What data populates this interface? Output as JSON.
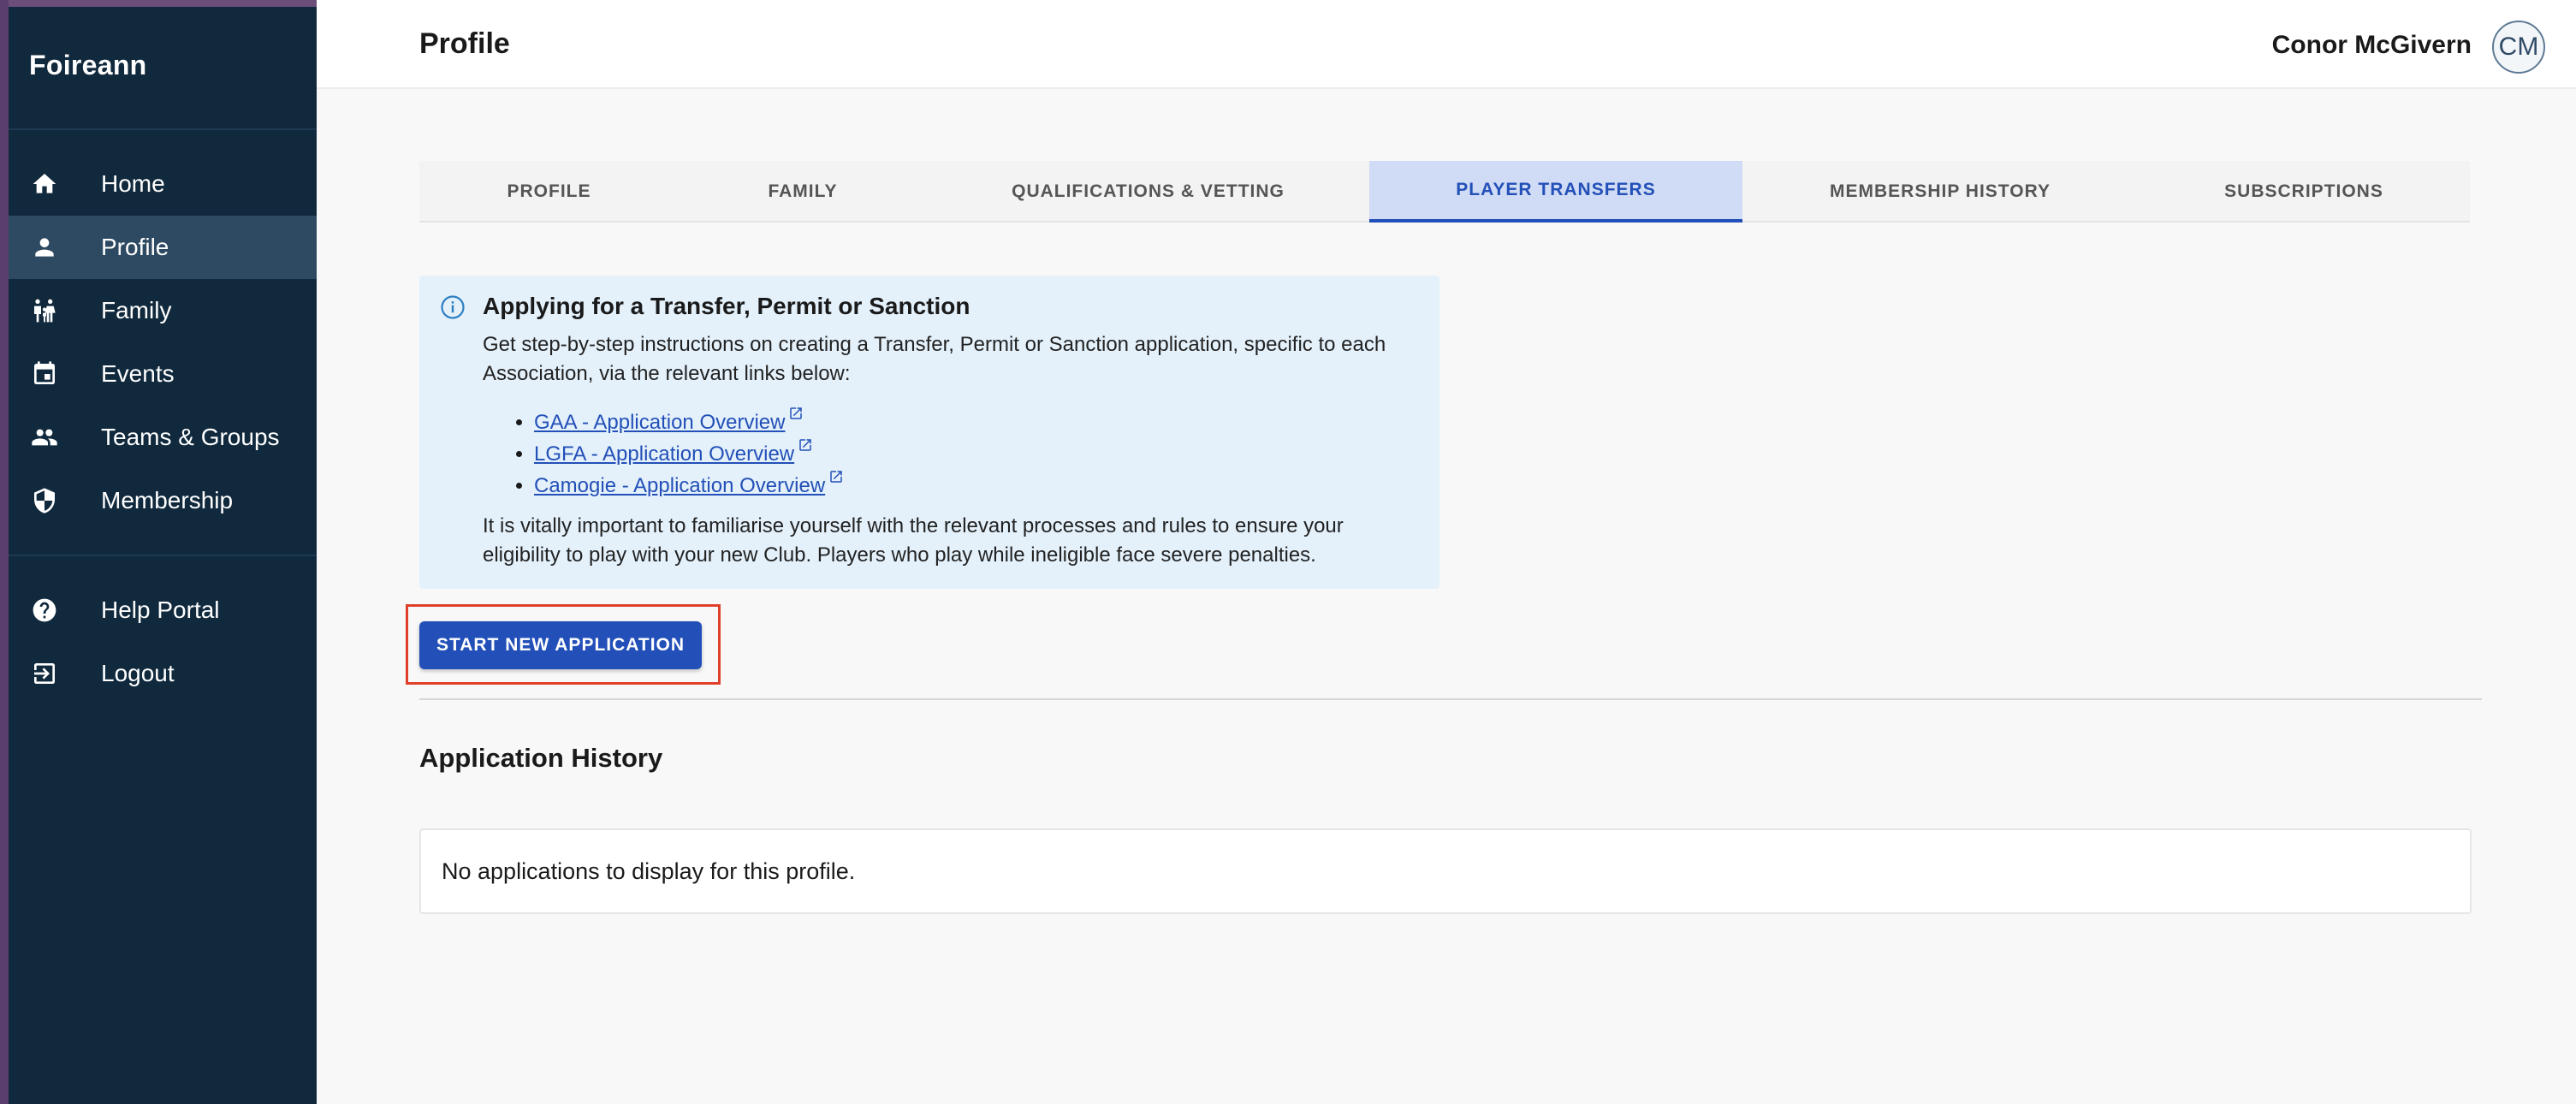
{
  "app": {
    "name": "Foireann"
  },
  "sidebar": {
    "items": [
      {
        "label": "Home",
        "icon": "home-icon"
      },
      {
        "label": "Profile",
        "icon": "person-icon",
        "active": true
      },
      {
        "label": "Family",
        "icon": "family-icon"
      },
      {
        "label": "Events",
        "icon": "calendar-icon"
      },
      {
        "label": "Teams & Groups",
        "icon": "group-icon"
      },
      {
        "label": "Membership",
        "icon": "shield-icon"
      }
    ],
    "secondary_items": [
      {
        "label": "Help Portal",
        "icon": "help-icon"
      },
      {
        "label": "Logout",
        "icon": "logout-icon"
      }
    ]
  },
  "header": {
    "title": "Profile",
    "user_name": "Conor McGivern",
    "avatar_initials": "CM"
  },
  "tabs": [
    {
      "label": "PROFILE"
    },
    {
      "label": "FAMILY"
    },
    {
      "label": "QUALIFICATIONS & VETTING"
    },
    {
      "label": "PLAYER TRANSFERS",
      "active": true
    },
    {
      "label": "MEMBERSHIP HISTORY"
    },
    {
      "label": "SUBSCRIPTIONS"
    }
  ],
  "info": {
    "title": "Applying for a Transfer, Permit or Sanction",
    "description": "Get step-by-step instructions on creating a Transfer, Permit or Sanction application, specific to each Association, via the relevant links below:",
    "links": [
      "GAA - Application Overview",
      "LGFA - Application Overview",
      "Camogie - Application Overview"
    ],
    "warning": "It is vitally important to familiarise yourself with the relevant processes and rules to ensure your eligibility to play with your new Club. Players who play while ineligible face severe penalties."
  },
  "actions": {
    "start_application": "START NEW APPLICATION"
  },
  "history": {
    "title": "Application History",
    "empty_message": "No applications to display for this profile."
  },
  "colors": {
    "sidebar_bg": "#11293d",
    "accent": "#2350b8",
    "info_bg": "#e4f1fb",
    "highlight": "#e0402a"
  }
}
